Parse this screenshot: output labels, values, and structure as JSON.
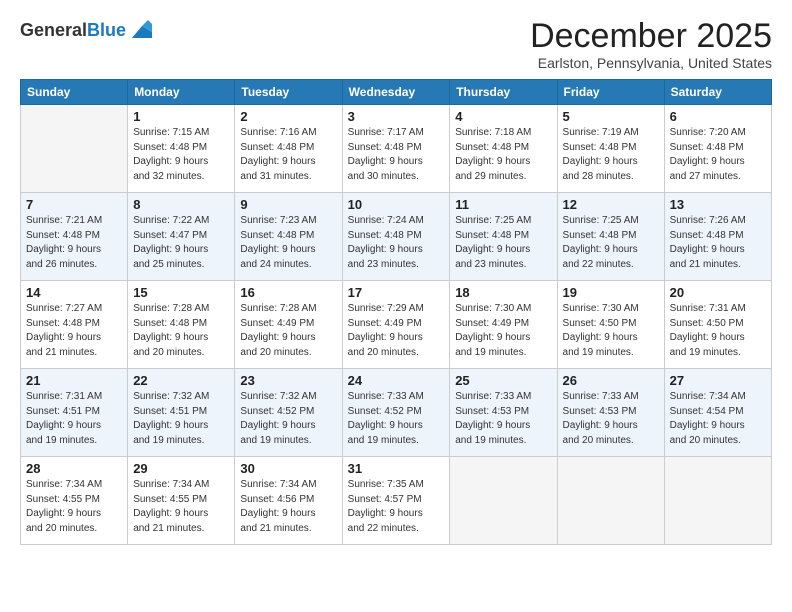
{
  "logo": {
    "general": "General",
    "blue": "Blue"
  },
  "header": {
    "month": "December 2025",
    "location": "Earlston, Pennsylvania, United States"
  },
  "days_of_week": [
    "Sunday",
    "Monday",
    "Tuesday",
    "Wednesday",
    "Thursday",
    "Friday",
    "Saturday"
  ],
  "weeks": [
    [
      {
        "day": "",
        "info": ""
      },
      {
        "day": "1",
        "info": "Sunrise: 7:15 AM\nSunset: 4:48 PM\nDaylight: 9 hours\nand 32 minutes."
      },
      {
        "day": "2",
        "info": "Sunrise: 7:16 AM\nSunset: 4:48 PM\nDaylight: 9 hours\nand 31 minutes."
      },
      {
        "day": "3",
        "info": "Sunrise: 7:17 AM\nSunset: 4:48 PM\nDaylight: 9 hours\nand 30 minutes."
      },
      {
        "day": "4",
        "info": "Sunrise: 7:18 AM\nSunset: 4:48 PM\nDaylight: 9 hours\nand 29 minutes."
      },
      {
        "day": "5",
        "info": "Sunrise: 7:19 AM\nSunset: 4:48 PM\nDaylight: 9 hours\nand 28 minutes."
      },
      {
        "day": "6",
        "info": "Sunrise: 7:20 AM\nSunset: 4:48 PM\nDaylight: 9 hours\nand 27 minutes."
      }
    ],
    [
      {
        "day": "7",
        "info": "Sunrise: 7:21 AM\nSunset: 4:48 PM\nDaylight: 9 hours\nand 26 minutes."
      },
      {
        "day": "8",
        "info": "Sunrise: 7:22 AM\nSunset: 4:47 PM\nDaylight: 9 hours\nand 25 minutes."
      },
      {
        "day": "9",
        "info": "Sunrise: 7:23 AM\nSunset: 4:48 PM\nDaylight: 9 hours\nand 24 minutes."
      },
      {
        "day": "10",
        "info": "Sunrise: 7:24 AM\nSunset: 4:48 PM\nDaylight: 9 hours\nand 23 minutes."
      },
      {
        "day": "11",
        "info": "Sunrise: 7:25 AM\nSunset: 4:48 PM\nDaylight: 9 hours\nand 23 minutes."
      },
      {
        "day": "12",
        "info": "Sunrise: 7:25 AM\nSunset: 4:48 PM\nDaylight: 9 hours\nand 22 minutes."
      },
      {
        "day": "13",
        "info": "Sunrise: 7:26 AM\nSunset: 4:48 PM\nDaylight: 9 hours\nand 21 minutes."
      }
    ],
    [
      {
        "day": "14",
        "info": "Sunrise: 7:27 AM\nSunset: 4:48 PM\nDaylight: 9 hours\nand 21 minutes."
      },
      {
        "day": "15",
        "info": "Sunrise: 7:28 AM\nSunset: 4:48 PM\nDaylight: 9 hours\nand 20 minutes."
      },
      {
        "day": "16",
        "info": "Sunrise: 7:28 AM\nSunset: 4:49 PM\nDaylight: 9 hours\nand 20 minutes."
      },
      {
        "day": "17",
        "info": "Sunrise: 7:29 AM\nSunset: 4:49 PM\nDaylight: 9 hours\nand 20 minutes."
      },
      {
        "day": "18",
        "info": "Sunrise: 7:30 AM\nSunset: 4:49 PM\nDaylight: 9 hours\nand 19 minutes."
      },
      {
        "day": "19",
        "info": "Sunrise: 7:30 AM\nSunset: 4:50 PM\nDaylight: 9 hours\nand 19 minutes."
      },
      {
        "day": "20",
        "info": "Sunrise: 7:31 AM\nSunset: 4:50 PM\nDaylight: 9 hours\nand 19 minutes."
      }
    ],
    [
      {
        "day": "21",
        "info": "Sunrise: 7:31 AM\nSunset: 4:51 PM\nDaylight: 9 hours\nand 19 minutes."
      },
      {
        "day": "22",
        "info": "Sunrise: 7:32 AM\nSunset: 4:51 PM\nDaylight: 9 hours\nand 19 minutes."
      },
      {
        "day": "23",
        "info": "Sunrise: 7:32 AM\nSunset: 4:52 PM\nDaylight: 9 hours\nand 19 minutes."
      },
      {
        "day": "24",
        "info": "Sunrise: 7:33 AM\nSunset: 4:52 PM\nDaylight: 9 hours\nand 19 minutes."
      },
      {
        "day": "25",
        "info": "Sunrise: 7:33 AM\nSunset: 4:53 PM\nDaylight: 9 hours\nand 19 minutes."
      },
      {
        "day": "26",
        "info": "Sunrise: 7:33 AM\nSunset: 4:53 PM\nDaylight: 9 hours\nand 20 minutes."
      },
      {
        "day": "27",
        "info": "Sunrise: 7:34 AM\nSunset: 4:54 PM\nDaylight: 9 hours\nand 20 minutes."
      }
    ],
    [
      {
        "day": "28",
        "info": "Sunrise: 7:34 AM\nSunset: 4:55 PM\nDaylight: 9 hours\nand 20 minutes."
      },
      {
        "day": "29",
        "info": "Sunrise: 7:34 AM\nSunset: 4:55 PM\nDaylight: 9 hours\nand 21 minutes."
      },
      {
        "day": "30",
        "info": "Sunrise: 7:34 AM\nSunset: 4:56 PM\nDaylight: 9 hours\nand 21 minutes."
      },
      {
        "day": "31",
        "info": "Sunrise: 7:35 AM\nSunset: 4:57 PM\nDaylight: 9 hours\nand 22 minutes."
      },
      {
        "day": "",
        "info": ""
      },
      {
        "day": "",
        "info": ""
      },
      {
        "day": "",
        "info": ""
      }
    ]
  ]
}
